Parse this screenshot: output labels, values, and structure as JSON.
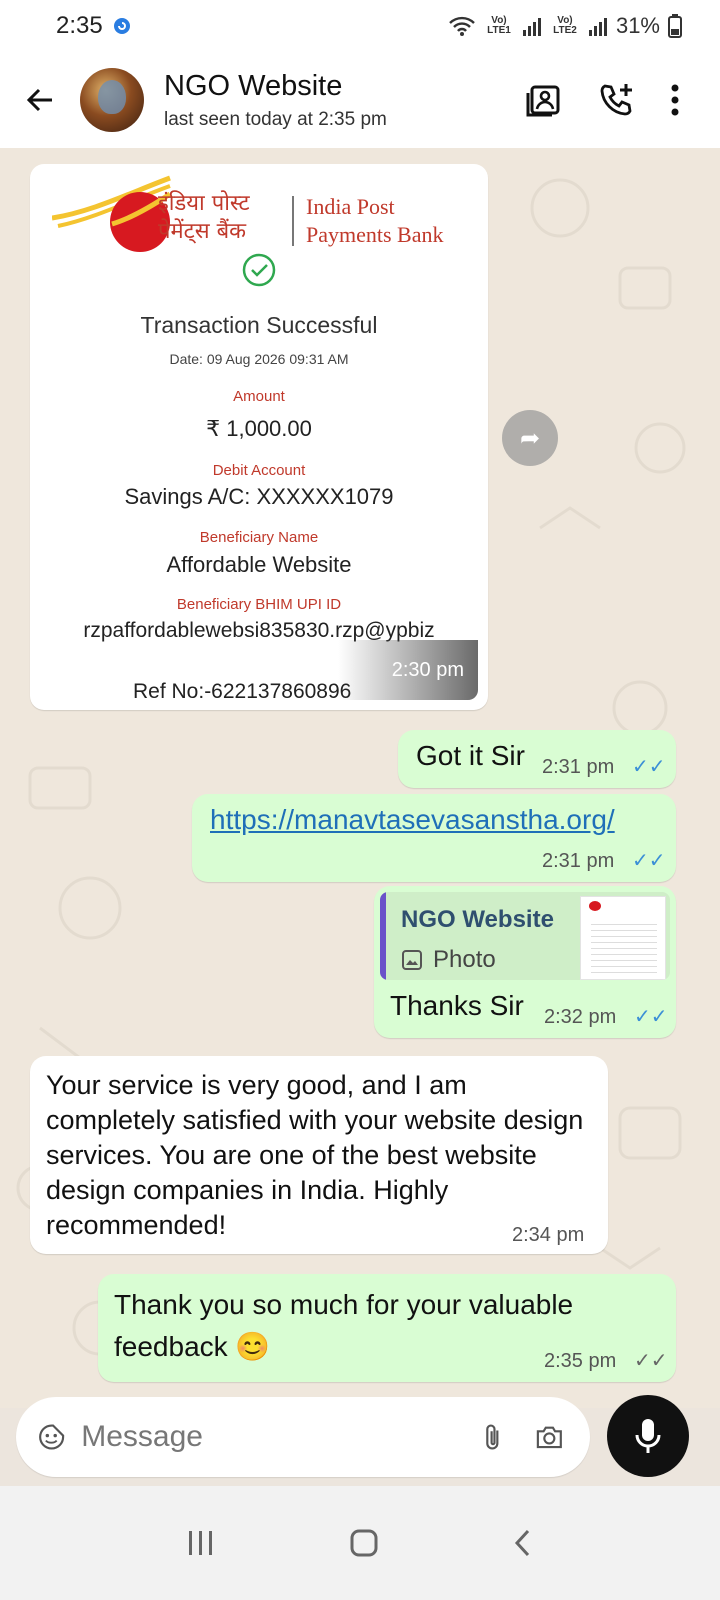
{
  "status": {
    "time": "2:35",
    "sim1": "Vo) LTE1",
    "sim2": "Vo) LTE2",
    "battery": "31%"
  },
  "header": {
    "contact_name": "NGO Website",
    "last_seen": "last seen today at 2:35 pm"
  },
  "receipt": {
    "bank_hindi": "इंडिया पोस्ट पेमेंट्स बैंक",
    "bank_line1": "India Post",
    "bank_line2": "Payments Bank",
    "title": "Transaction Successful",
    "date": "Date: 09 Aug 2026 09:31 AM",
    "amount_label": "Amount",
    "amount_value": "₹ 1,000.00",
    "debit_label": "Debit Account",
    "debit_value": "Savings A/C: XXXXXX1079",
    "beneficiary_label": "Beneficiary Name",
    "beneficiary_value": "Affordable Website",
    "upi_label": "Beneficiary BHIM UPI ID",
    "upi_value": "rzpaffordablewebsi835830.rzp@ypbiz",
    "ref": "Ref No:-622137860896",
    "time": "2:30 pm"
  },
  "messages": {
    "got_it": {
      "text": "Got it Sir",
      "time": "2:31 pm"
    },
    "link": {
      "text": "https://manavtasevasanstha.org/",
      "time": "2:31 pm"
    },
    "reply": {
      "quote_author": "NGO Website",
      "quote_type": "Photo",
      "text": "Thanks Sir",
      "time": "2:32 pm"
    },
    "review": {
      "text": "Your service is very good, and I am completely satisfied with your website design services. You are one of the best website design companies in India. Highly recommended!",
      "time": "2:34 pm"
    },
    "thanks": {
      "text": "Thank you so much for your valuable feedback 😊",
      "time": "2:35 pm"
    }
  },
  "input": {
    "placeholder": "Message"
  },
  "colors": {
    "outgoing_bubble": "#d9fdd3",
    "incoming_bubble": "#ffffff",
    "read_ticks": "#3b8fd6",
    "link": "#1f6fb8",
    "quote_bar": "#6a52c9"
  }
}
